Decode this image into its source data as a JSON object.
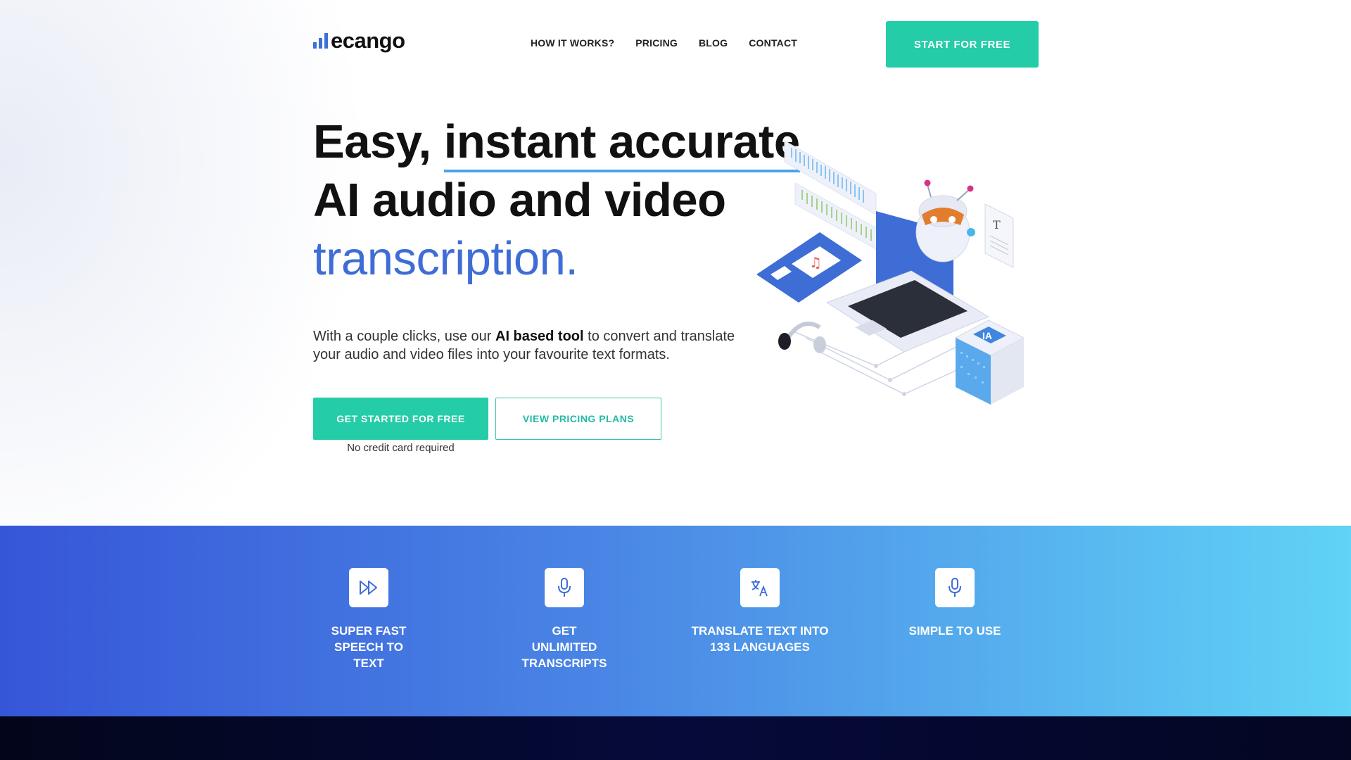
{
  "header": {
    "logo_text": "ecango",
    "nav": [
      {
        "label": "HOW IT WORKS?"
      },
      {
        "label": "PRICING"
      },
      {
        "label": "BLOG"
      },
      {
        "label": "CONTACT"
      }
    ],
    "cta_label": "START FOR FREE"
  },
  "hero": {
    "headline_part1": "Easy, ",
    "headline_underlined": "instant accurate",
    "headline_line2": "AI audio and video",
    "headline_line3": "transcription.",
    "sub_part1": "With a couple clicks, use our ",
    "sub_bold": "AI based tool",
    "sub_part2": " to convert and translate your audio and video files into your favourite text formats.",
    "primary_button": "GET STARTED FOR FREE",
    "secondary_button": "VIEW PRICING PLANS",
    "note": "No credit card required"
  },
  "features": [
    {
      "icon": "fast-forward-icon",
      "label": "SUPER FAST SPEECH TO TEXT"
    },
    {
      "icon": "microphone-icon",
      "label": "GET UNLIMITED TRANSCRIPTS"
    },
    {
      "icon": "translate-icon",
      "label": "TRANSLATE TEXT INTO 133 LANGUAGES"
    },
    {
      "icon": "microphone-icon",
      "label": "SIMPLE TO USE"
    }
  ],
  "colors": {
    "accent": "#24cca7",
    "brand_blue": "#3f6dd6",
    "band_start": "#3656d8",
    "band_end": "#60d3f6"
  }
}
